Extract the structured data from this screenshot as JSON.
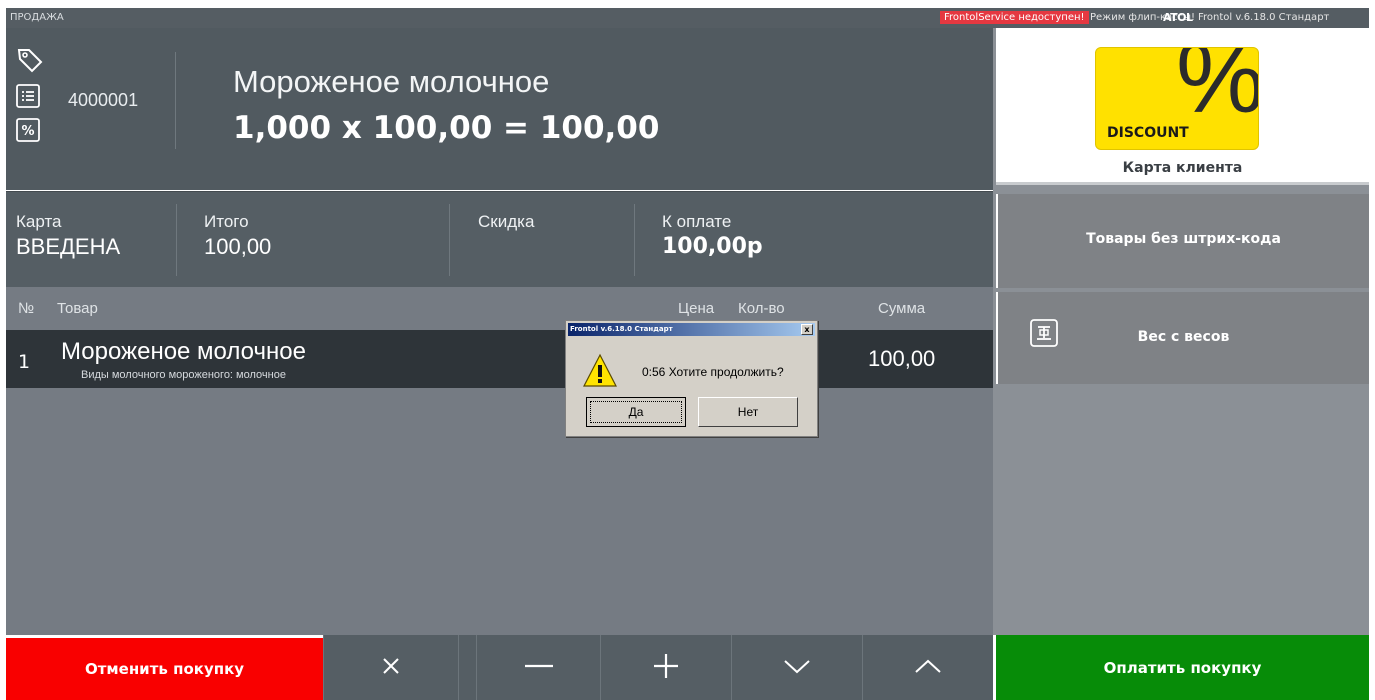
{
  "topbar": {
    "mode": "ПРОДАЖА",
    "service_error": "FrontolService недоступен!",
    "flip_mode": "Режим флип-кассы!",
    "brand": "ATOL",
    "version": "Frontol v.6.18.0 Стандарт"
  },
  "header": {
    "code": "4000001",
    "product_name": "Мороженое молочное",
    "calc_line": "1,000 х 100,00 = 100,00",
    "icons": [
      "tag-icon",
      "list-icon",
      "percent-icon"
    ]
  },
  "summary": {
    "card_label": "Карта",
    "card_value": "ВВЕДЕНА",
    "total_label": "Итого",
    "total_value": "100,00",
    "discount_label": "Скидка",
    "pay_label": "К оплате",
    "pay_value": "100,00р"
  },
  "table": {
    "columns": {
      "num": "№",
      "product": "Товар",
      "price": "Цена",
      "qty": "Кол-во",
      "sum": "Сумма"
    },
    "rows": [
      {
        "num": "1",
        "name": "Мороженое молочное",
        "subtitle": "Виды молочного мороженого: молочное",
        "sum": "100,00"
      }
    ]
  },
  "right_panel": {
    "discount_card_text": "DISCOUNT",
    "discount_symbol": "%",
    "client_card_label": "Карта клиента",
    "no_barcode_label": "Товары без штрих-кода",
    "scale_label": "Вес с весов"
  },
  "toolbar": {
    "cancel_label": "Отменить покупку",
    "pay_label": "Оплатить покупку",
    "tools": [
      "close-icon",
      "minus-icon",
      "plus-icon",
      "chevron-down-icon",
      "chevron-up-icon"
    ]
  },
  "dialog": {
    "title": "Frontol v.6.18.0 Стандарт",
    "message": "0:56  Хотите продолжить?",
    "yes_label": "Да",
    "no_label": "Нет",
    "close_glyph": "x"
  },
  "colors": {
    "cancel": "#f90000",
    "pay": "#078c08",
    "discount_card": "#ffe100",
    "error_badge": "#e53841"
  }
}
